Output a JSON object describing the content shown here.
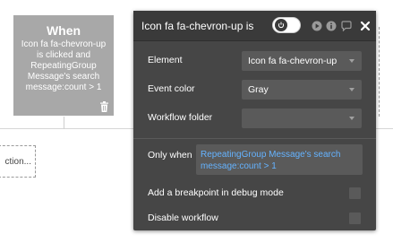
{
  "event_card": {
    "title": "When",
    "description": "Icon fa fa-chevron-up is clicked and RepeatingGroup Message's search message:count > 1"
  },
  "action_placeholder": {
    "label": "ction..."
  },
  "panel": {
    "title": "Icon fa fa-chevron-up is c",
    "header_icons": [
      "power-icon",
      "play-icon",
      "info-icon",
      "comment-icon",
      "close-icon"
    ],
    "element": {
      "label": "Element",
      "value": "Icon fa fa-chevron-up"
    },
    "event_color": {
      "label": "Event color",
      "value": "Gray"
    },
    "workflow_folder": {
      "label": "Workflow folder",
      "value": ""
    },
    "only_when": {
      "label": "Only when",
      "value": "RepeatingGroup Message's search message:count > 1"
    },
    "breakpoint": {
      "label": "Add a breakpoint in debug mode",
      "checked": false
    },
    "disable": {
      "label": "Disable workflow",
      "checked": false
    }
  },
  "colors": {
    "panel_bg": "#464646",
    "event_card_bg": "#a8a8a8",
    "expression_text": "#65b3ff"
  }
}
